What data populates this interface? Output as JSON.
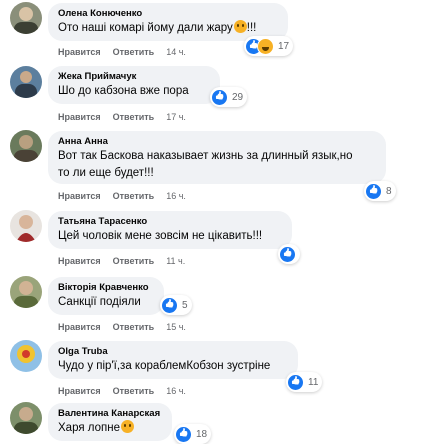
{
  "labels": {
    "like": "Нравится",
    "reply": "Ответить"
  },
  "comments": [
    {
      "author": "Олена Конюченко",
      "lines": [
        "Ото наші комарі йому дали жару"
      ],
      "emoji_after": [
        "!!!"
      ],
      "reactions": [
        "like",
        "haha"
      ],
      "count": "17",
      "time": "14 ч."
    },
    {
      "author": "Жека Приймачук",
      "lines": [
        "Шо до кабзона вже пора"
      ],
      "emoji_after": [
        ""
      ],
      "reactions": [
        "like"
      ],
      "count": "29",
      "time": "17 ч."
    },
    {
      "author": "Анна Анна",
      "lines": [
        "Вот так Баскова наказывает жизнь за длинный язык,но",
        "то ли еще будет!!!"
      ],
      "emoji_after": [
        "",
        ""
      ],
      "reactions": [
        "like"
      ],
      "count": "8",
      "time": "16 ч."
    },
    {
      "author": "Татьяна Тарасенко",
      "lines": [
        "Цей чоловік мене зовсім не цікавить!!!"
      ],
      "emoji_after": [
        ""
      ],
      "reactions": [
        "like"
      ],
      "count": "",
      "time": "11 ч."
    },
    {
      "author": "Вікторія Кравченко",
      "lines": [
        "Санкції подіяли"
      ],
      "emoji_after": [
        ""
      ],
      "reactions": [
        "like"
      ],
      "count": "5",
      "time": "15 ч."
    },
    {
      "author": "Olga Truba",
      "lines": [
        "Чудо у пір'ї,за кораблемКобзон зустріне"
      ],
      "emoji_after": [
        ""
      ],
      "reactions": [
        "like"
      ],
      "count": "11",
      "time": "16 ч."
    },
    {
      "author": "Валентина Канарская",
      "lines": [
        "Харя лопне"
      ],
      "emoji_after": [
        ""
      ],
      "reactions": [
        "like"
      ],
      "count": "18",
      "time": ""
    }
  ]
}
